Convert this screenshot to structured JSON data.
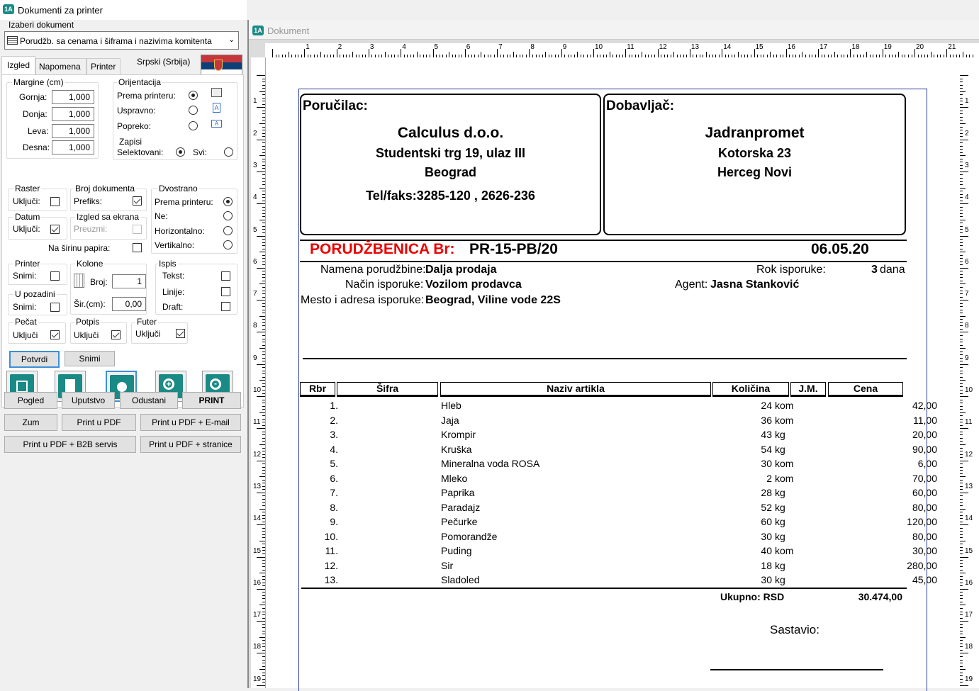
{
  "app": {
    "title": "Dokumenti za printer"
  },
  "selector": {
    "label": "Izaberi dokument",
    "value": "Porudžb. sa cenama i šiframa i nazivima komitenta"
  },
  "tabs": [
    "Izgled",
    "Napomena",
    "Printer"
  ],
  "language": "Srpski (Srbija)",
  "margins": {
    "title": "Margine (cm)",
    "rows": [
      {
        "label": "Gornja:",
        "value": "1,000"
      },
      {
        "label": "Donja:",
        "value": "1,000"
      },
      {
        "label": "Leva:",
        "value": "1,000"
      },
      {
        "label": "Desna:",
        "value": "1,000"
      }
    ]
  },
  "orientation": {
    "title": "Orijentacija",
    "rows": [
      "Prema printeru:",
      "Uspravno:",
      "Popreko:"
    ]
  },
  "zapisi": {
    "title": "Zapisi",
    "selected": "Selektovani:",
    "all": "Svi:"
  },
  "raster": {
    "title": "Raster",
    "label": "Uključi:"
  },
  "broj": {
    "title": "Broj dokumenta",
    "label": "Prefiks:"
  },
  "dvostrano": {
    "title": "Dvostrano",
    "rows": [
      "Prema printeru:",
      "Ne:",
      "Horizontalno:",
      "Vertikalno:"
    ]
  },
  "datum": {
    "title": "Datum",
    "label": "Uključi:"
  },
  "izgled_ekran": {
    "title": "Izgled sa ekrana",
    "label": "Preuzmi:"
  },
  "sirina": "Na širinu papira:",
  "printer_grp": {
    "title": "Printer",
    "label": "Snimi:"
  },
  "pozadina": {
    "title": "U pozadini",
    "label": "Snimi:"
  },
  "kolone": {
    "title": "Kolone",
    "broj_label": "Broj:",
    "broj": "1",
    "sir_label": "Šir.(cm):",
    "sir": "0,00"
  },
  "ispis": {
    "title": "Ispis",
    "rows": [
      "Tekst:",
      "Linije:",
      "Draft:"
    ]
  },
  "pecat": {
    "title": "Pečat",
    "label": "Uključi"
  },
  "potpis": {
    "title": "Potpis",
    "label": "Uključi"
  },
  "futer": {
    "title": "Futer",
    "label": "Uključi"
  },
  "buttons": {
    "potvrdi": "Potvrdi",
    "snimi": "Snimi",
    "pogled": "Pogled",
    "uputstvo": "Uputstvo",
    "odustani": "Odustani",
    "print": "PRINT",
    "zum": "Zum",
    "pdf": "Print u PDF",
    "pdf_email": "Print u PDF + E-mail",
    "pdf_b2b": "Print u PDF + B2B servis",
    "pdf_str": "Print u PDF + stranice"
  },
  "preview": {
    "title": "Dokument",
    "ruler": [
      "1",
      "2",
      "3",
      "4",
      "5",
      "6",
      "7",
      "8",
      "9",
      "10",
      "11",
      "12",
      "13",
      "14",
      "15",
      "16",
      "17",
      "18",
      "19",
      "20",
      "21"
    ]
  },
  "doc": {
    "buyer_label": "Poručilac:",
    "buyer_name": "Calculus d.o.o.",
    "buyer_addr": "Studentski trg 19, ulaz III",
    "buyer_city": "Beograd",
    "buyer_tel": "Tel/faks:3285-120 , 2626-236",
    "supplier_label": "Dobavljač:",
    "supplier_name": "Jadranpromet",
    "supplier_addr": "Kotorska 23",
    "supplier_city": "Herceg Novi",
    "order_label": "PORUDŽBENICA Br:",
    "order_no": "PR-15-PB/20",
    "date": "06.05.20",
    "namena_l": "Namena porudžbine:",
    "namena_v": "Dalja prodaja",
    "nacin_l": "Način isporuke:",
    "nacin_v": "Vozilom prodavca",
    "mesto_l": "Mesto i adresa isporuke:",
    "mesto_v": "Beograd, Viline vode 22S",
    "rok_l": "Rok isporuke:",
    "rok_v": "3",
    "rok_u": "dana",
    "agent_l": "Agent:",
    "agent_v": "Jasna Stanković",
    "cols": [
      "Rbr",
      "Šifra",
      "Naziv artikla",
      "Količina",
      "J.M.",
      "Cena"
    ],
    "rows": [
      [
        "1.",
        "",
        "Hleb",
        "24",
        "kom",
        "42,00"
      ],
      [
        "2.",
        "",
        "Jaja",
        "36",
        "kom",
        "11,00"
      ],
      [
        "3.",
        "",
        "Krompir",
        "43",
        "kg",
        "20,00"
      ],
      [
        "4.",
        "",
        "Kruška",
        "54",
        "kg",
        "90,00"
      ],
      [
        "5.",
        "",
        "Mineralna voda ROSA",
        "30",
        "kom",
        "6,00"
      ],
      [
        "6.",
        "",
        "Mleko",
        "2",
        "kom",
        "70,00"
      ],
      [
        "7.",
        "",
        "Paprika",
        "28",
        "kg",
        "60,00"
      ],
      [
        "8.",
        "",
        "Paradajz",
        "52",
        "kg",
        "80,00"
      ],
      [
        "9.",
        "",
        "Pečurke",
        "60",
        "kg",
        "120,00"
      ],
      [
        "10.",
        "",
        "Pomorandže",
        "30",
        "kg",
        "80,00"
      ],
      [
        "11.",
        "",
        "Puding",
        "40",
        "kom",
        "30,00"
      ],
      [
        "12.",
        "",
        "Sir",
        "18",
        "kg",
        "280,00"
      ],
      [
        "13.",
        "",
        "Sladoled",
        "30",
        "kg",
        "45,00"
      ]
    ],
    "total_label": "Ukupno: RSD",
    "total": "30.474,00",
    "sastavio": "Sastavio:"
  }
}
